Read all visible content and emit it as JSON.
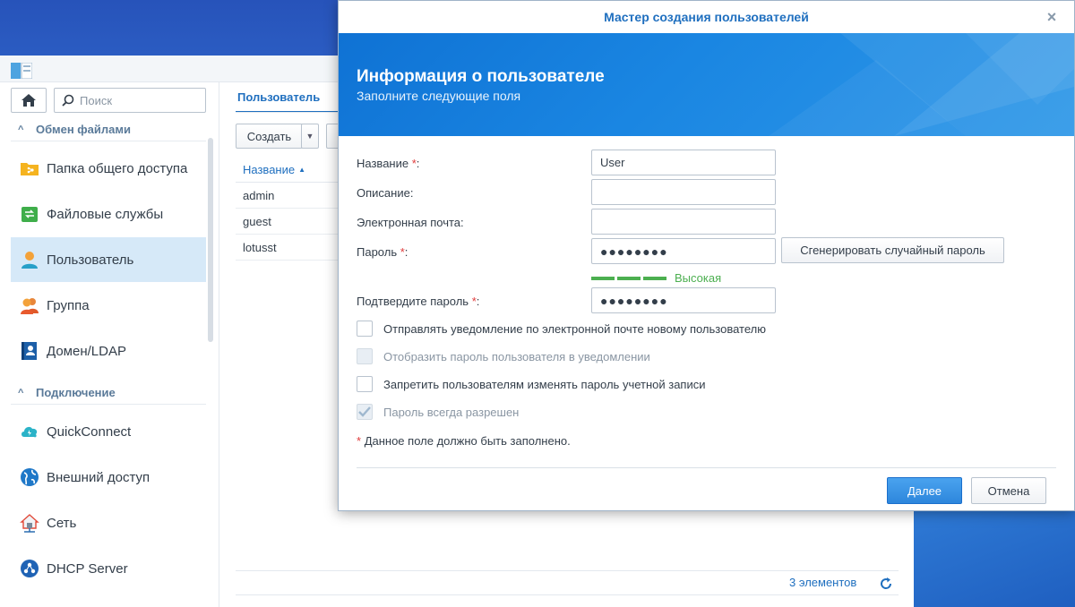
{
  "sidebar": {
    "search_placeholder": "Поиск",
    "sections": [
      {
        "label": "Обмен файлами"
      },
      {
        "label": "Подключение"
      }
    ],
    "items": [
      {
        "label": "Папка общего доступа",
        "icon": "shared-folder-icon"
      },
      {
        "label": "Файловые службы",
        "icon": "file-services-icon"
      },
      {
        "label": "Пользователь",
        "icon": "user-icon",
        "active": true
      },
      {
        "label": "Группа",
        "icon": "group-icon"
      },
      {
        "label": "Домен/LDAP",
        "icon": "domain-ldap-icon"
      },
      {
        "label": "QuickConnect",
        "icon": "quickconnect-icon"
      },
      {
        "label": "Внешний доступ",
        "icon": "external-access-icon"
      },
      {
        "label": "Сеть",
        "icon": "network-icon"
      },
      {
        "label": "DHCP Server",
        "icon": "dhcp-server-icon"
      }
    ]
  },
  "content": {
    "tab_label": "Пользователь",
    "create_button": "Создать",
    "column_name": "Название",
    "rows": [
      "admin",
      "guest",
      "lotusst"
    ],
    "count_text": "3 элементов"
  },
  "dialog": {
    "title": "Мастер создания пользователей",
    "banner_title": "Информация о пользователе",
    "banner_subtitle": "Заполните следующие поля",
    "fields": {
      "name_label": "Название",
      "name_value": "User",
      "description_label": "Описание:",
      "email_label": "Электронная почта:",
      "password_label": "Пароль",
      "password_value": "●●●●●●●●",
      "confirm_label": "Подтвердите пароль",
      "confirm_value": "●●●●●●●●"
    },
    "required_mark": "*",
    "colon": ":",
    "generate_button": "Сгенерировать случайный пароль",
    "strength_text": "Высокая",
    "checkboxes": [
      {
        "label": "Отправлять уведомление по электронной почте новому пользователю",
        "checked": false,
        "disabled": false
      },
      {
        "label": "Отобразить пароль пользователя в уведомлении",
        "checked": false,
        "disabled": true
      },
      {
        "label": "Запретить пользователям изменять пароль учетной записи",
        "checked": false,
        "disabled": false
      },
      {
        "label": "Пароль всегда разрешен",
        "checked": true,
        "disabled": true
      }
    ],
    "required_note": "Данное поле должно быть заполнено.",
    "next_button": "Далее",
    "cancel_button": "Отмена"
  },
  "colors": {
    "accent": "#1f6fbf",
    "primary_button": "#2d86dc",
    "strength_green": "#4caf50",
    "required_red": "#e03c3c"
  }
}
